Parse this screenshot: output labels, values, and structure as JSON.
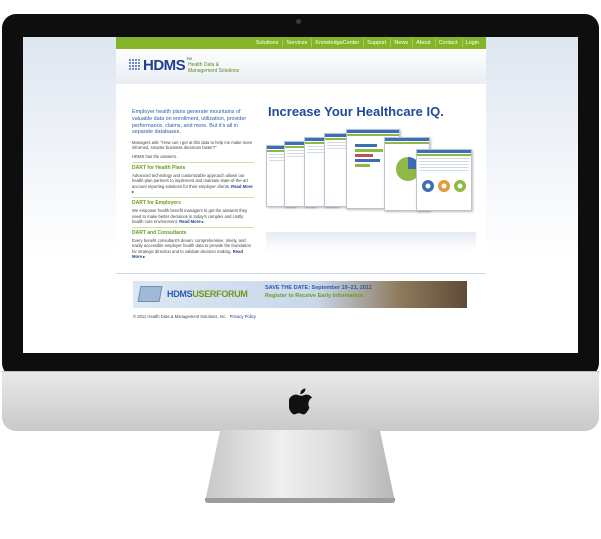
{
  "nav": {
    "items": [
      "Solutions",
      "Services",
      "KnowledgeCenter",
      "Support",
      "News",
      "About",
      "Contact",
      "Login"
    ]
  },
  "brand": {
    "logo": "HDMS",
    "tm": "TM",
    "subtitle_line1": "Health Data &",
    "subtitle_line2": "Management Solutions"
  },
  "intro": {
    "headline": "Employer health plans generate mountains of valuable data on enrollment, utilization, provider performance, claims, and more. But it's all in separate databases.",
    "quote": "Managers ask: \"How can I get at this data to help me make more informed, smarter business decisions faster?\"",
    "answer": "HDMS has the answers."
  },
  "sections": [
    {
      "title": "DART for Health Plans",
      "text": "Advanced technology and customizable approach allows our health plan partners to implement and maintain state-of-the-art account reporting solutions for their employer clients.",
      "link": "Read More ▸"
    },
    {
      "title": "DART for Employers",
      "text": "We empower health benefit managers to get the answers they need to make better decisions in today's complex and costly health care environment.",
      "link": "Read More ▸"
    },
    {
      "title": "DART and Consultants",
      "text": "Every benefit consultant's dream: comprehensive, timely, and easily accessible employer health data to provide the foundation for strategic direction and to validate decision making.",
      "link": "Read More ▸"
    }
  ],
  "hero": {
    "title": "Increase Your Healthcare IQ."
  },
  "banner": {
    "forum_part1": "HDMS",
    "forum_part2": "USERFORUM",
    "date": "SAVE THE DATE: September 19–21, 2011",
    "register": "Register to Receive Early Information."
  },
  "footer": {
    "copyright": "© 2011 Health Data & Management Solutions, Inc.",
    "privacy": "Privacy Policy"
  },
  "colors": {
    "nav_green": "#84b528",
    "brand_blue": "#1f4b99",
    "accent_green": "#6a9a1e"
  }
}
